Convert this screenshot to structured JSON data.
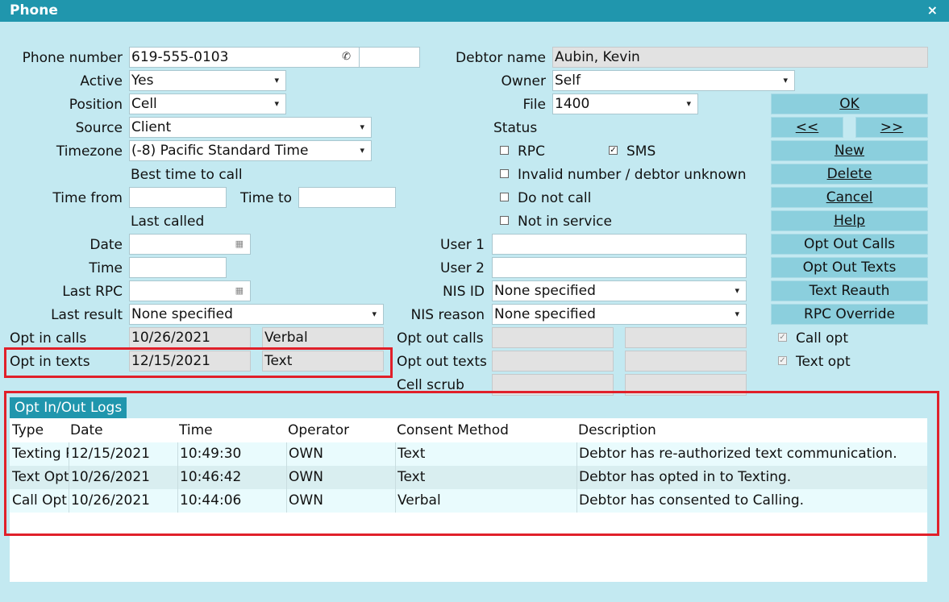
{
  "window": {
    "title": "Phone",
    "close": "×"
  },
  "form": {
    "phone_number": {
      "label": "Phone number",
      "value": "619-555-0103",
      "ext": ""
    },
    "active": {
      "label": "Active",
      "value": "Yes"
    },
    "position": {
      "label": "Position",
      "value": "Cell"
    },
    "source": {
      "label": "Source",
      "value": "Client"
    },
    "timezone": {
      "label": "Timezone",
      "value": "(-8) Pacific Standard Time"
    },
    "best_time": "Best time to call",
    "time_from": {
      "label": "Time from",
      "value": ""
    },
    "time_to": {
      "label": "Time to",
      "value": ""
    },
    "last_called": "Last called",
    "date": {
      "label": "Date",
      "value": ""
    },
    "time": {
      "label": "Time",
      "value": ""
    },
    "last_rpc": {
      "label": "Last RPC",
      "value": ""
    },
    "last_result": {
      "label": "Last result",
      "value": "None specified"
    },
    "opt_in_calls": {
      "label": "Opt in calls",
      "date": "10/26/2021",
      "method": "Verbal"
    },
    "opt_in_texts": {
      "label": "Opt in texts",
      "date": "12/15/2021",
      "method": "Text"
    }
  },
  "right": {
    "debtor_name": {
      "label": "Debtor name",
      "value": "Aubin, Kevin"
    },
    "owner": {
      "label": "Owner",
      "value": "Self"
    },
    "file": {
      "label": "File",
      "value": "1400"
    },
    "status": {
      "label": "Status",
      "rpc": {
        "label": "RPC",
        "checked": false
      },
      "sms": {
        "label": "SMS",
        "checked": true,
        "mark": "✓"
      },
      "invalid": {
        "label": "Invalid number / debtor unknown",
        "checked": false
      },
      "do_not_call": {
        "label": "Do not call",
        "checked": false
      },
      "not_in_service": {
        "label": "Not in service",
        "checked": false
      }
    },
    "user1": {
      "label": "User 1",
      "value": ""
    },
    "user2": {
      "label": "User 2",
      "value": ""
    },
    "nis_id": {
      "label": "NIS ID",
      "value": "None specified"
    },
    "nis_reason": {
      "label": "NIS reason",
      "value": "None specified"
    },
    "opt_out_calls": {
      "label": "Opt out calls",
      "date": "",
      "method": ""
    },
    "opt_out_texts": {
      "label": "Opt out texts",
      "date": "",
      "method": ""
    },
    "cell_scrub": {
      "label": "Cell scrub",
      "date": "",
      "method": ""
    }
  },
  "buttons": {
    "ok": "OK",
    "prev": "<<",
    "next": ">>",
    "new": "New",
    "delete": "Delete",
    "cancel": "Cancel",
    "help": "Help",
    "opt_out_calls": "Opt Out Calls",
    "opt_out_texts": "Opt Out Texts",
    "text_reauth": "Text Reauth",
    "rpc_override": "RPC Override"
  },
  "opts": {
    "call_opt": {
      "label": "Call opt",
      "checked": true,
      "mark": "✓"
    },
    "text_opt": {
      "label": "Text opt",
      "checked": true,
      "mark": "✓"
    }
  },
  "logs": {
    "tab": "Opt In/Out Logs",
    "columns": [
      "Type",
      "Date",
      "Time",
      "Operator",
      "Consent Method",
      "Description"
    ],
    "rows": [
      {
        "type": "Texting Reauth",
        "date": "12/15/2021",
        "time": "10:49:30",
        "operator": "OWN",
        "method": "Text",
        "description": "Debtor has re-authorized text communication."
      },
      {
        "type": "Text Opt",
        "date": "10/26/2021",
        "time": "10:46:42",
        "operator": "OWN",
        "method": "Text",
        "description": "Debtor has opted in to Texting."
      },
      {
        "type": "Call Opt",
        "date": "10/26/2021",
        "time": "10:44:06",
        "operator": "OWN",
        "method": "Verbal",
        "description": "Debtor has consented to Calling."
      }
    ]
  },
  "icons": {
    "dropdown": "▾",
    "calendar": "▦",
    "phone": "✆"
  },
  "colors": {
    "accent": "#2096ad",
    "background": "#c3e9f1",
    "button": "#8bcfdd",
    "highlight": "#e0202a"
  }
}
